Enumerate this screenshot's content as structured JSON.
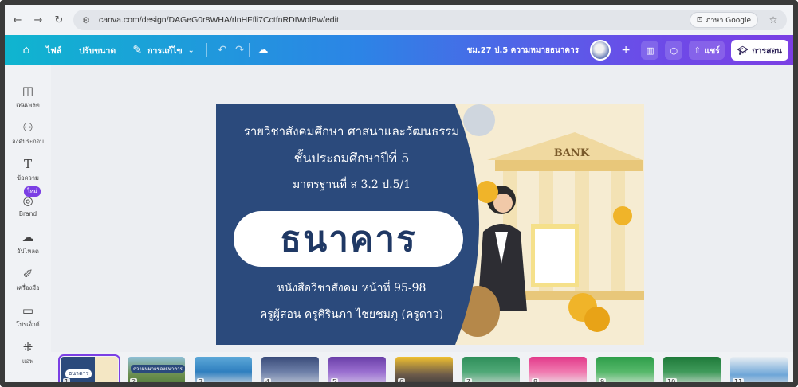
{
  "browser": {
    "url": "canva.com/design/DAGeG0r8WHA/rlnHFfli7CctfnRDIWolBw/edit",
    "translate_label": "ภาษา Google",
    "icons": [
      "back-icon",
      "forward-icon",
      "reload-icon",
      "site-settings-icon",
      "translate-icon",
      "star-icon",
      "extensions-icon",
      "profile-icon",
      "more-icon"
    ]
  },
  "header": {
    "file_label": "ไฟล์",
    "resize_label": "ปรับขนาด",
    "edit_label": "การแก้ไข",
    "design_title": "ชม.27 ป.5 ความหมายธนาคาร",
    "share_label": "แชร์",
    "teach_label": "การสอน",
    "colors": {
      "start": "#0fb5cf",
      "mid": "#2c84e6",
      "end": "#7b3fe4"
    }
  },
  "sidebar": {
    "items": [
      {
        "icon": "template-icon",
        "label": "เทมเพลต"
      },
      {
        "icon": "elements-icon",
        "label": "องค์ประกอบ"
      },
      {
        "icon": "text-icon",
        "label": "ข้อความ"
      },
      {
        "icon": "brand-icon",
        "label": "Brand",
        "badge": "ใหม่"
      },
      {
        "icon": "upload-icon",
        "label": "อัปโหลด"
      },
      {
        "icon": "tools-icon",
        "label": "เครื่องมือ"
      },
      {
        "icon": "projects-icon",
        "label": "โปรเจ็กต์"
      },
      {
        "icon": "apps-icon",
        "label": "แอพ"
      }
    ]
  },
  "slide": {
    "line1": "รายวิชาสังคมศึกษา ศาสนาและวัฒนธรรม",
    "line2": "ชั้นประถมศึกษาปีที่ 5",
    "line3": "มาตรฐานที่ ส 3.2 ป.5/1",
    "headline": "ธนาคาร",
    "line4": "หนังสือวิชาสังคม หน้าที่ 95-98",
    "line5": "ครูผู้สอน ครูศิรินภา ไชยชมภู (ครูดาว)",
    "bank_sign": "BANK"
  },
  "thumbnails": [
    {
      "num": "1",
      "label": "ธนาคาร"
    },
    {
      "num": "2",
      "label": "ความหมายของธนาคาร"
    },
    {
      "num": "3",
      "label": ""
    },
    {
      "num": "4",
      "label": ""
    },
    {
      "num": "5",
      "label": ""
    },
    {
      "num": "6",
      "label": ""
    },
    {
      "num": "7",
      "label": ""
    },
    {
      "num": "8",
      "label": ""
    },
    {
      "num": "9",
      "label": ""
    },
    {
      "num": "10",
      "label": ""
    },
    {
      "num": "11",
      "label": ""
    }
  ]
}
